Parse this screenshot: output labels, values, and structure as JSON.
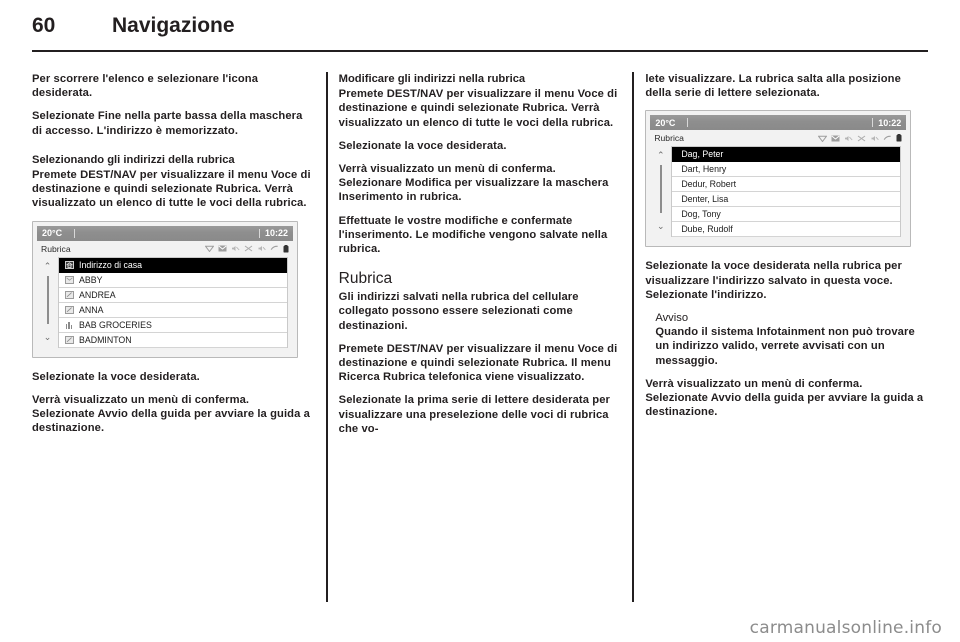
{
  "header": {
    "page_number": "60",
    "chapter": "Navigazione"
  },
  "columns": {
    "left": {
      "p1": "Per scorrere l'elenco e selezionare l'icona desiderata.",
      "p2": "Selezionate Fine nella parte bassa della maschera di accesso. L'indirizzo è memorizzato.",
      "h1": "Selezionando gli indirizzi della rubrica",
      "p3": "Premete DEST/NAV per visualizzare il menu Voce di destinazione e quindi selezionate Rubrica. Verrà visualizzato un elenco di tutte le voci della rubrica.",
      "p4": "Selezionate la voce desiderata.",
      "p5": "Verrà visualizzato un menù di conferma. Selezionate Avvio della guida per avviare la guida a destinazione."
    },
    "middle": {
      "h1": "Modificare gli indirizzi nella rubrica",
      "p1": "Premete DEST/NAV per visualizzare il menu Voce di destinazione e quindi selezionate Rubrica. Verrà visualizzato un elenco di tutte le voci della rubrica.",
      "p2": "Selezionate la voce desiderata.",
      "p3": "Verrà visualizzato un menù di conferma. Selezionare Modifica per visualizzare la maschera Inserimento in rubrica.",
      "p4": "Effettuate le vostre modifiche e confermate l'inserimento. Le modifiche vengono salvate nella rubrica.",
      "h2": "Rubrica",
      "p5": "Gli indirizzi salvati nella rubrica del cellulare collegato possono essere selezionati come destinazioni.",
      "p6": "Premete DEST/NAV per visualizzare il menu Voce di destinazione e quindi selezionate Rubrica. Il menu Ricerca Rubrica telefonica viene visualizzato.",
      "p7": "Selezionate la prima serie di lettere desiderata per visualizzare una preselezione delle voci di rubrica che vo-"
    },
    "right": {
      "p1": "lete visualizzare. La rubrica salta alla posizione della serie di lettere selezionata.",
      "p2": "Selezionate la voce desiderata nella rubrica per visualizzare l'indirizzo salvato in questa voce. Selezionate l'indirizzo.",
      "note_title": "Avviso",
      "note_body": "Quando il sistema Infotainment non può trovare un indirizzo valido, verrete avvisati con un messaggio.",
      "p3": "Verrà visualizzato un menù di conferma. Selezionate Avvio della guida per avviare la guida a destinazione."
    }
  },
  "device_screens": [
    {
      "id": "rubrica-indirizzi",
      "temperature": "20°C",
      "clock": "10:22",
      "title": "Rubrica",
      "status_icons": [
        "wifi-icon",
        "envelope-icon",
        "volume-mute-icon",
        "bluetooth-off-icon",
        "speaker-mute-icon",
        "phone-icon",
        "battery-icon"
      ],
      "scroll_up": "⌃",
      "scroll_down": "⌄",
      "rows": [
        {
          "label": "Indirizzo di casa",
          "icon": "home-address-icon",
          "selected": true
        },
        {
          "label": "ABBY",
          "icon": "contact-card-icon",
          "selected": false
        },
        {
          "label": "ANDREA",
          "icon": "contact-card-icon",
          "selected": false
        },
        {
          "label": "ANNA",
          "icon": "contact-card-icon",
          "selected": false
        },
        {
          "label": "BAB GROCERIES",
          "icon": "phone-bars-icon",
          "selected": false
        },
        {
          "label": "BADMINTON",
          "icon": "contact-card-icon",
          "selected": false
        }
      ]
    },
    {
      "id": "rubrica-telefonica",
      "temperature": "20°C",
      "clock": "10:22",
      "title": "Rubrica",
      "status_icons": [
        "wifi-icon",
        "envelope-icon",
        "volume-mute-icon",
        "bluetooth-off-icon",
        "speaker-mute-icon",
        "phone-icon",
        "battery-icon"
      ],
      "scroll_up": "⌃",
      "scroll_down": "⌄",
      "rows": [
        {
          "label": "Dag, Peter",
          "icon": "",
          "selected": true
        },
        {
          "label": "Dart, Henry",
          "icon": "",
          "selected": false
        },
        {
          "label": "Dedur, Robert",
          "icon": "",
          "selected": false
        },
        {
          "label": "Denter, Lisa",
          "icon": "",
          "selected": false
        },
        {
          "label": "Dog, Tony",
          "icon": "",
          "selected": false
        },
        {
          "label": "Dube, Rudolf",
          "icon": "",
          "selected": false
        }
      ]
    }
  ],
  "watermark": "carmanualsonline.info",
  "colors": {
    "text": "#231f20",
    "rule": "#231f20",
    "device_statusbar": "#8e8e8e",
    "device_panel": "#f2f2f2",
    "selection": "#000000",
    "watermark": "#8c8c8c"
  }
}
